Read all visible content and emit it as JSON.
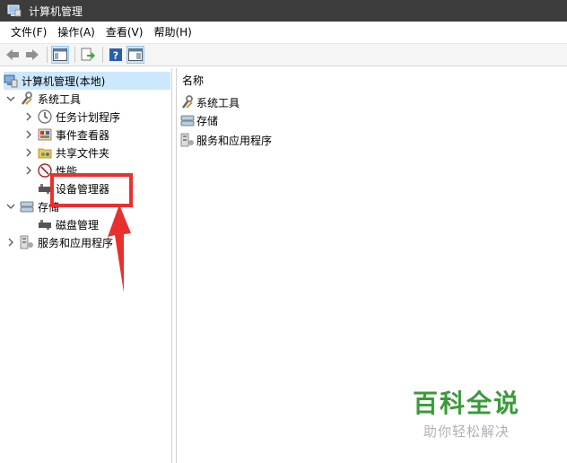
{
  "window": {
    "title": "计算机管理"
  },
  "menu": [
    "文件(F)",
    "操作(A)",
    "查看(V)",
    "帮助(H)"
  ],
  "toolbar": [
    "back-icon",
    "forward-icon",
    "show-tree-icon",
    "export-icon",
    "help-icon",
    "properties-icon"
  ],
  "tree": {
    "root": "计算机管理(本地)",
    "system_tools": "系统工具",
    "task_scheduler": "任务计划程序",
    "event_viewer": "事件查看器",
    "shared_folders": "共享文件夹",
    "performance": "性能",
    "device_manager": "设备管理器",
    "storage": "存储",
    "disk_management": "磁盘管理",
    "services_apps": "服务和应用程序"
  },
  "list": {
    "header": "名称",
    "items": [
      "系统工具",
      "存储",
      "服务和应用程序"
    ]
  },
  "watermark": {
    "main": "百科全说",
    "sub": "助你轻松解决"
  },
  "colors": {
    "titlebar": "#3c3c3c",
    "highlight": "#e8302f",
    "watermark": "#3a9a3a"
  }
}
